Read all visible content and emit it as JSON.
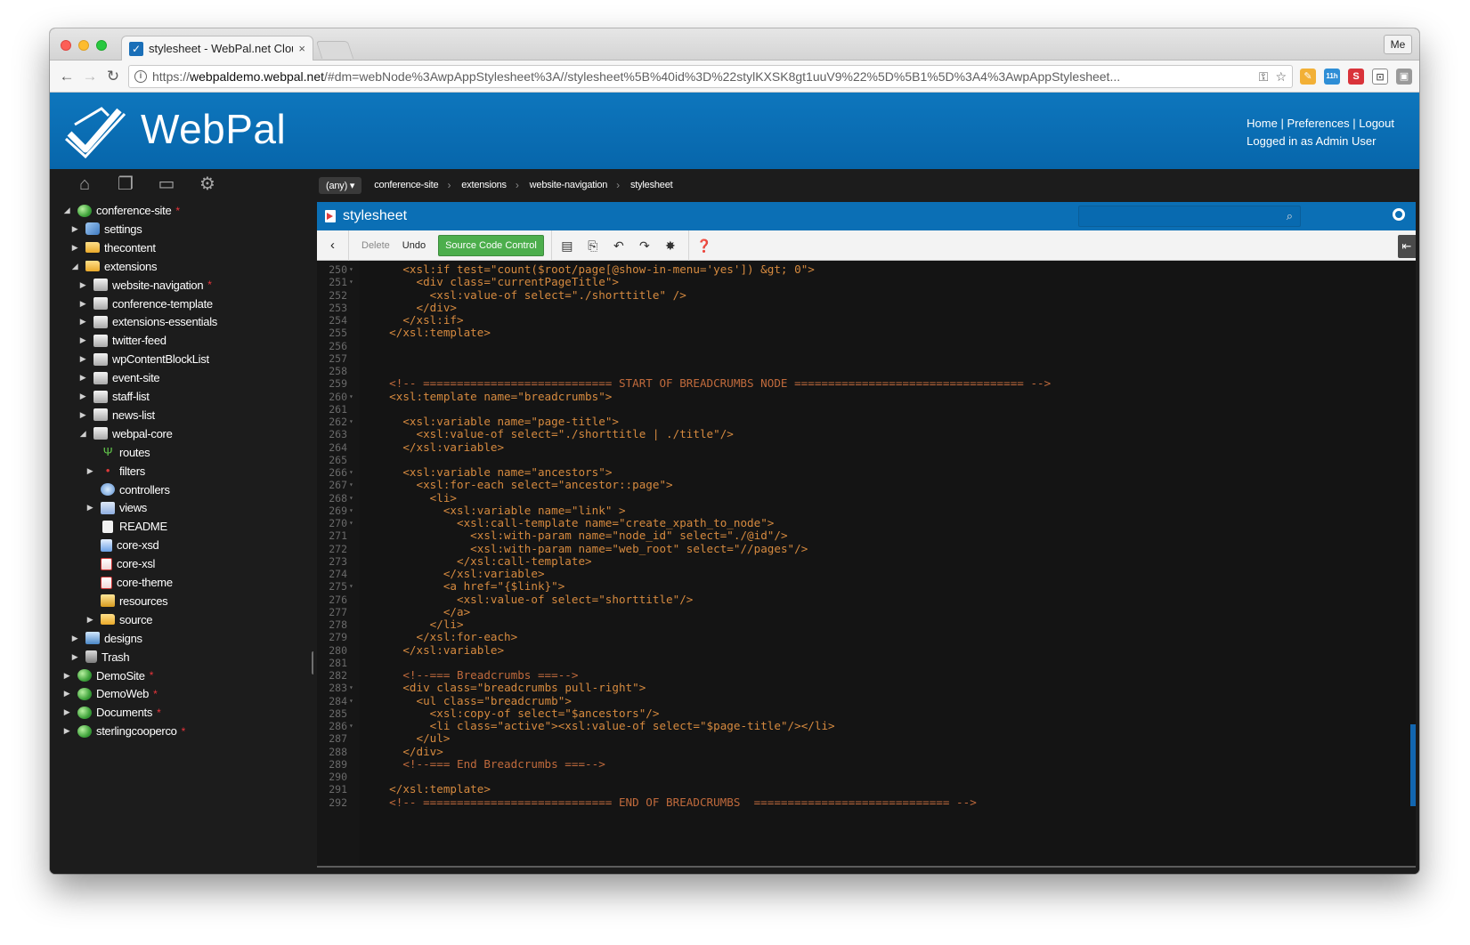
{
  "browser": {
    "tab_title": "stylesheet - WebPal.net Cloud",
    "tab_close": "×",
    "profile": "Me",
    "url_prefix": "https://",
    "url_host": "webpaldemo.webpal.net",
    "url_path": "/#dm=webNode%3AwpAppStylesheet%3A//stylesheet%5B%40id%3D%22stylKXSK8gt1uuV9%22%5D%5B1%5D%3A4%3AwpAppStylesheet...",
    "back_icon": "arrow-left-icon",
    "forward_icon": "arrow-right-icon",
    "reload_icon": "reload-icon",
    "extension_badge": "11h"
  },
  "header": {
    "logo": "WebPal",
    "links": [
      "Home",
      "Preferences",
      "Logout"
    ],
    "link_separator": "|",
    "logged_in": "Logged in as Admin User",
    "color": "#0b6fb5"
  },
  "sidebar": {
    "tools": [
      "home-icon",
      "pages-icon",
      "monitor-icon",
      "gear-icon"
    ],
    "tree": [
      {
        "label": "conference-site",
        "depth": 0,
        "arrow": "down",
        "icon": "globe",
        "modified": true
      },
      {
        "label": "settings",
        "depth": 1,
        "arrow": "right",
        "icon": "wrench",
        "modified": false
      },
      {
        "label": "thecontent",
        "depth": 1,
        "arrow": "right",
        "icon": "folder",
        "modified": false
      },
      {
        "label": "extensions",
        "depth": 1,
        "arrow": "down",
        "icon": "folder",
        "modified": false
      },
      {
        "label": "website-navigation",
        "depth": 2,
        "arrow": "right",
        "icon": "package",
        "modified": true
      },
      {
        "label": "conference-template",
        "depth": 2,
        "arrow": "right",
        "icon": "package",
        "modified": false
      },
      {
        "label": "extensions-essentials",
        "depth": 2,
        "arrow": "right",
        "icon": "package",
        "modified": false
      },
      {
        "label": "twitter-feed",
        "depth": 2,
        "arrow": "right",
        "icon": "package",
        "modified": false
      },
      {
        "label": "wpContentBlockList",
        "depth": 2,
        "arrow": "right",
        "icon": "package",
        "modified": false
      },
      {
        "label": "event-site",
        "depth": 2,
        "arrow": "right",
        "icon": "package",
        "modified": false
      },
      {
        "label": "staff-list",
        "depth": 2,
        "arrow": "right",
        "icon": "package",
        "modified": false
      },
      {
        "label": "news-list",
        "depth": 2,
        "arrow": "right",
        "icon": "package",
        "modified": false
      },
      {
        "label": "webpal-core",
        "depth": 2,
        "arrow": "down",
        "icon": "package",
        "modified": false
      },
      {
        "label": "routes",
        "depth": 3,
        "arrow": "none",
        "icon": "route",
        "modified": false
      },
      {
        "label": "filters",
        "depth": 3,
        "arrow": "right",
        "icon": "filter",
        "modified": false
      },
      {
        "label": "controllers",
        "depth": 3,
        "arrow": "none",
        "icon": "controller",
        "modified": false
      },
      {
        "label": "views",
        "depth": 3,
        "arrow": "right",
        "icon": "views",
        "modified": false
      },
      {
        "label": "README",
        "depth": 3,
        "arrow": "none",
        "icon": "document",
        "modified": false
      },
      {
        "label": "core-xsd",
        "depth": 3,
        "arrow": "none",
        "icon": "xsd",
        "modified": false
      },
      {
        "label": "core-xsl",
        "depth": 3,
        "arrow": "none",
        "icon": "xsl",
        "modified": false
      },
      {
        "label": "core-theme",
        "depth": 3,
        "arrow": "none",
        "icon": "xsl",
        "modified": false
      },
      {
        "label": "resources",
        "depth": 3,
        "arrow": "none",
        "icon": "resources",
        "modified": false
      },
      {
        "label": "source",
        "depth": 3,
        "arrow": "right",
        "icon": "folder",
        "modified": false
      },
      {
        "label": "designs",
        "depth": 1,
        "arrow": "right",
        "icon": "design",
        "modified": false
      },
      {
        "label": "Trash",
        "depth": 1,
        "arrow": "right",
        "icon": "trash",
        "modified": false
      },
      {
        "label": "DemoSite",
        "depth": 0,
        "arrow": "right",
        "icon": "globe",
        "modified": true
      },
      {
        "label": "DemoWeb",
        "depth": 0,
        "arrow": "right",
        "icon": "globe",
        "modified": true
      },
      {
        "label": "Documents",
        "depth": 0,
        "arrow": "right",
        "icon": "globe",
        "modified": true
      },
      {
        "label": "sterlingcooperco",
        "depth": 0,
        "arrow": "right",
        "icon": "globe",
        "modified": true
      }
    ],
    "modified_mark": "*"
  },
  "breadcrumb": {
    "scope": "(any)",
    "items": [
      "conference-site",
      "extensions",
      "website-navigation",
      "stylesheet"
    ],
    "separator": "›"
  },
  "editor": {
    "title": "stylesheet",
    "toolbar": {
      "delete": "Delete",
      "undo": "Undo",
      "source_control": "Source Code Control",
      "icons": [
        "save-icon",
        "preview-icon",
        "undo-arrow-icon",
        "redo-arrow-icon",
        "bug-icon",
        "help-icon"
      ]
    },
    "lines": [
      {
        "n": 250,
        "fold": true,
        "t": "    <xsl:if test=\"count($root/page[@show-in-menu='yes']) &gt; 0\">"
      },
      {
        "n": 251,
        "fold": true,
        "t": "      <div class=\"currentPageTitle\">"
      },
      {
        "n": 252,
        "fold": false,
        "t": "        <xsl:value-of select=\"./shorttitle\" />"
      },
      {
        "n": 253,
        "fold": false,
        "t": "      </div>"
      },
      {
        "n": 254,
        "fold": false,
        "t": "    </xsl:if>"
      },
      {
        "n": 255,
        "fold": false,
        "t": "  </xsl:template>"
      },
      {
        "n": 256,
        "fold": false,
        "t": ""
      },
      {
        "n": 257,
        "fold": false,
        "t": ""
      },
      {
        "n": 258,
        "fold": false,
        "t": ""
      },
      {
        "n": 259,
        "fold": false,
        "t": "  <!-- ============================ START OF BREADCRUMBS NODE ================================== -->"
      },
      {
        "n": 260,
        "fold": true,
        "t": "  <xsl:template name=\"breadcrumbs\">"
      },
      {
        "n": 261,
        "fold": false,
        "t": ""
      },
      {
        "n": 262,
        "fold": true,
        "t": "    <xsl:variable name=\"page-title\">"
      },
      {
        "n": 263,
        "fold": false,
        "t": "      <xsl:value-of select=\"./shorttitle | ./title\"/>"
      },
      {
        "n": 264,
        "fold": false,
        "t": "    </xsl:variable>"
      },
      {
        "n": 265,
        "fold": false,
        "t": ""
      },
      {
        "n": 266,
        "fold": true,
        "t": "    <xsl:variable name=\"ancestors\">"
      },
      {
        "n": 267,
        "fold": true,
        "t": "      <xsl:for-each select=\"ancestor::page\">"
      },
      {
        "n": 268,
        "fold": true,
        "t": "        <li>"
      },
      {
        "n": 269,
        "fold": true,
        "t": "          <xsl:variable name=\"link\" >"
      },
      {
        "n": 270,
        "fold": true,
        "t": "            <xsl:call-template name=\"create_xpath_to_node\">"
      },
      {
        "n": 271,
        "fold": false,
        "t": "              <xsl:with-param name=\"node_id\" select=\"./@id\"/>"
      },
      {
        "n": 272,
        "fold": false,
        "t": "              <xsl:with-param name=\"web_root\" select=\"//pages\"/>"
      },
      {
        "n": 273,
        "fold": false,
        "t": "            </xsl:call-template>"
      },
      {
        "n": 274,
        "fold": false,
        "t": "          </xsl:variable>"
      },
      {
        "n": 275,
        "fold": true,
        "t": "          <a href=\"{$link}\">"
      },
      {
        "n": 276,
        "fold": false,
        "t": "            <xsl:value-of select=\"shorttitle\"/>"
      },
      {
        "n": 277,
        "fold": false,
        "t": "          </a>"
      },
      {
        "n": 278,
        "fold": false,
        "t": "        </li>"
      },
      {
        "n": 279,
        "fold": false,
        "t": "      </xsl:for-each>"
      },
      {
        "n": 280,
        "fold": false,
        "t": "    </xsl:variable>"
      },
      {
        "n": 281,
        "fold": false,
        "t": ""
      },
      {
        "n": 282,
        "fold": false,
        "t": "    <!--=== Breadcrumbs ===-->"
      },
      {
        "n": 283,
        "fold": true,
        "t": "    <div class=\"breadcrumbs pull-right\">"
      },
      {
        "n": 284,
        "fold": true,
        "t": "      <ul class=\"breadcrumb\">"
      },
      {
        "n": 285,
        "fold": false,
        "t": "        <xsl:copy-of select=\"$ancestors\"/>"
      },
      {
        "n": 286,
        "fold": true,
        "t": "        <li class=\"active\"><xsl:value-of select=\"$page-title\"/></li>"
      },
      {
        "n": 287,
        "fold": false,
        "t": "      </ul>"
      },
      {
        "n": 288,
        "fold": false,
        "t": "    </div>"
      },
      {
        "n": 289,
        "fold": false,
        "t": "    <!--=== End Breadcrumbs ===-->"
      },
      {
        "n": 290,
        "fold": false,
        "t": ""
      },
      {
        "n": 291,
        "fold": false,
        "t": "  </xsl:template>"
      },
      {
        "n": 292,
        "fold": false,
        "t": "  <!-- ============================ END OF BREADCRUMBS  ============================= -->"
      }
    ],
    "colors": {
      "tag": "#d68a3f",
      "value": "#f1d38a",
      "comment": "#c06a3c",
      "background": "#141414"
    }
  }
}
